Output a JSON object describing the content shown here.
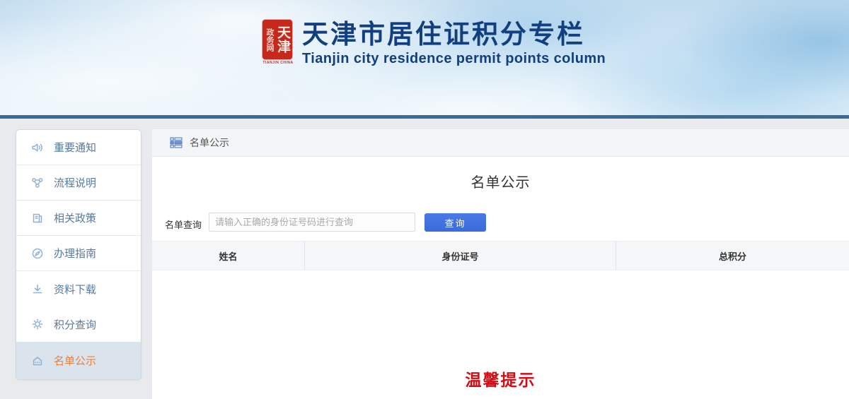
{
  "header": {
    "title": "天津市居住证积分专栏",
    "subtitle": "Tianjin city residence permit points column",
    "seal": {
      "main_chars": "天津",
      "side_chars": "政务网",
      "caption": "TIANJIN CHINA"
    }
  },
  "sidebar": {
    "items": [
      {
        "label": "重要通知",
        "icon": "speaker-icon",
        "active": false
      },
      {
        "label": "流程说明",
        "icon": "flow-icon",
        "active": false
      },
      {
        "label": "相关政策",
        "icon": "policy-icon",
        "active": false
      },
      {
        "label": "办理指南",
        "icon": "compass-icon",
        "active": false
      },
      {
        "label": "资料下载",
        "icon": "download-icon",
        "active": false
      },
      {
        "label": "积分查询",
        "icon": "points-icon",
        "active": false
      },
      {
        "label": "名单公示",
        "icon": "roster-icon",
        "active": true
      }
    ]
  },
  "main": {
    "breadcrumb": "名单公示",
    "page_title": "名单公示",
    "search": {
      "label": "名单查询",
      "placeholder": "请输入正确的身份证号码进行查询",
      "button": "查询",
      "value": ""
    },
    "table": {
      "columns": [
        "姓名",
        "身份证号",
        "总积分"
      ],
      "rows": []
    },
    "notice": "温馨提示"
  },
  "colors": {
    "brand_navy": "#123f7e",
    "header_divider_blue": "#3a6b94",
    "accent_button_blue": "#3e70e0",
    "active_item_orange": "#e8823e",
    "notice_red": "#d30c15",
    "seal_red": "#c6281b"
  }
}
